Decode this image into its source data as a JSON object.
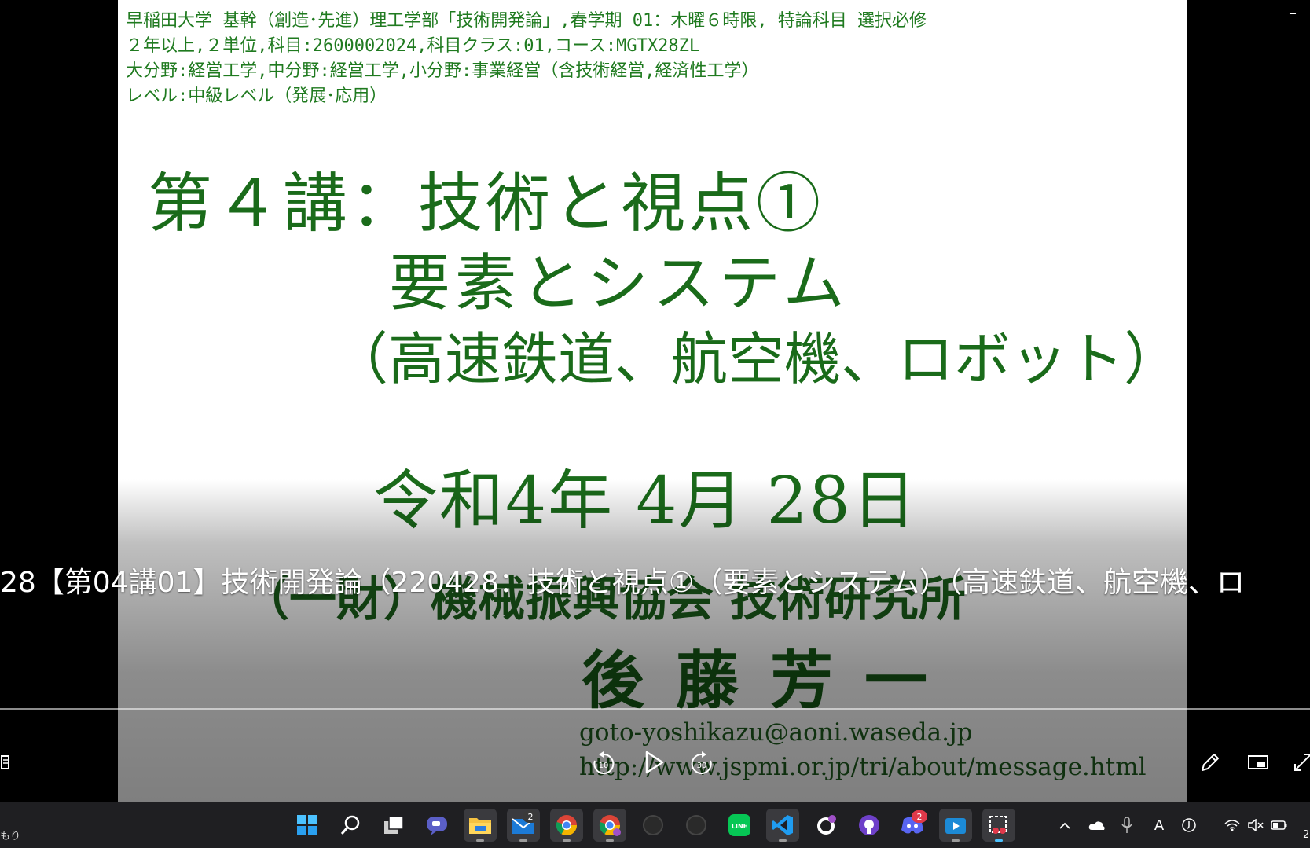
{
  "slide": {
    "header_lines": [
      "早稲田大学 基幹（創造･先進）理工学部「技術開発論」,春学期 01：木曜６時限, 特論科目 選択必修",
      "２年以上,２単位,科目:2600002024,科目クラス:01,コース:MGTX28ZL",
      "大分野:経営工学,中分野:経営工学,小分野:事業経営（含技術経営,経済性工学）",
      "レベル:中級レベル（発展･応用）"
    ],
    "title": "第４講：技術と視点①",
    "subtitle": "要素とシステム",
    "topics": "（高速鉄道、航空機、ロボット）",
    "date": "令和4年 4月 28日",
    "organization": "（一財）機械振興協会 技術研究所",
    "presenter": "後藤芳一",
    "email": "goto-yoshikazu@aoni.waseda.jp",
    "website": "http://www.jspmi.or.jp/tri/about/message.html"
  },
  "player": {
    "video_title": "28【第04講01】技術開発論（220428：技術と視点①（要素とシステム）（高速鉄道、航空機、ロ",
    "rewind_label": "10",
    "forward_label": "30",
    "minimize_label": "–"
  },
  "taskbar": {
    "weather_text": "もり",
    "clock_text": "2",
    "apps": [
      {
        "name": "start",
        "icon": "windows-logo"
      },
      {
        "name": "search",
        "icon": "search"
      },
      {
        "name": "task-view",
        "icon": "task-view"
      },
      {
        "name": "chat",
        "icon": "teams-chat"
      },
      {
        "name": "file-explorer",
        "icon": "folder"
      },
      {
        "name": "mail",
        "icon": "mail",
        "badge": "2"
      },
      {
        "name": "chrome",
        "icon": "chrome"
      },
      {
        "name": "chrome-profile",
        "icon": "chrome"
      },
      {
        "name": "app-dark-1",
        "icon": "generic"
      },
      {
        "name": "app-dark-2",
        "icon": "generic"
      },
      {
        "name": "line",
        "icon": "line",
        "label": "LINE"
      },
      {
        "name": "vscode",
        "icon": "vscode"
      },
      {
        "name": "github-desktop",
        "icon": "github"
      },
      {
        "name": "github",
        "icon": "github"
      },
      {
        "name": "discord",
        "icon": "discord",
        "badge": "2"
      },
      {
        "name": "media-player",
        "icon": "media-player"
      },
      {
        "name": "snipping-tool",
        "icon": "snipping-tool"
      }
    ],
    "tray": {
      "ime_label": "A",
      "colors": {
        "accent": "#0078d4",
        "mail_badge": "#3a3a3a",
        "discord_badge": "#e0394a",
        "line_green": "#06c755"
      }
    }
  }
}
